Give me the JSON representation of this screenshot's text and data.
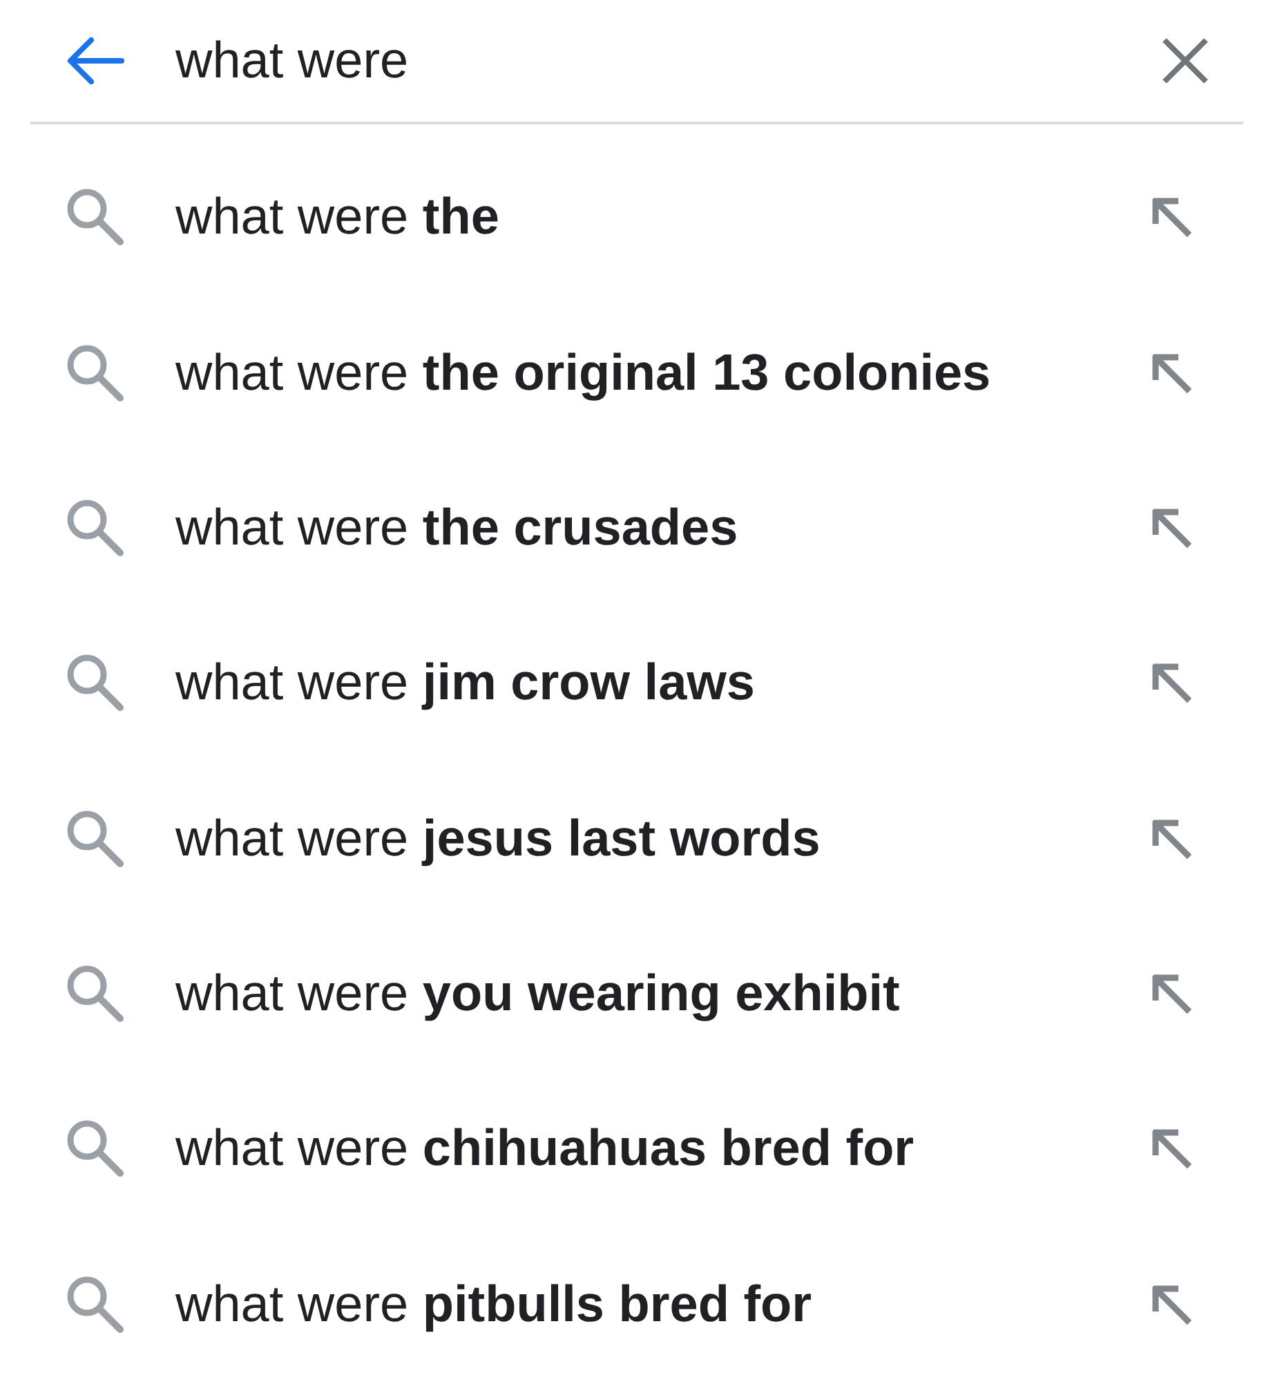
{
  "search_bar": {
    "query": "what were"
  },
  "suggestions": [
    {
      "text": "what were **the**"
    },
    {
      "text": "what were **the original 13 colonies**"
    },
    {
      "text": "what were **the crusades**"
    },
    {
      "text": "what were **jim crow laws**"
    },
    {
      "text": "what were **jesus last words**"
    },
    {
      "text": "what were **you wearing exhibit**"
    },
    {
      "text": "what were **chihuahuas bred for**"
    },
    {
      "text": "what were **pitbulls bred for**"
    }
  ]
}
